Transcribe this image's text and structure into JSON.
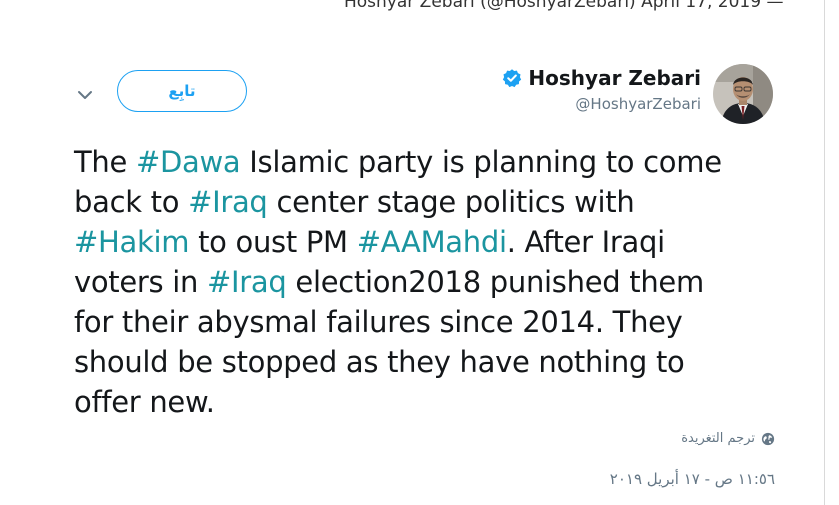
{
  "caption": "Hoshyar Zebari (@HoshyarZebari) April 17, 2019 —",
  "follow_label": "تابِع",
  "author": {
    "display_name": "Hoshyar Zebari",
    "handle": "@HoshyarZebari",
    "verified": true
  },
  "tweet_lines": [
    [
      {
        "t": "The "
      },
      {
        "t": "#Dawa",
        "tag": true
      },
      {
        "t": " Islamic party is planning to come"
      }
    ],
    [
      {
        "t": "back to "
      },
      {
        "t": "#Iraq",
        "tag": true
      },
      {
        "t": " center stage politics with"
      }
    ],
    [
      {
        "t": "#Hakim",
        "tag": true
      },
      {
        "t": "  to oust PM "
      },
      {
        "t": "#AAMahdi",
        "tag": true
      },
      {
        "t": ". After Iraqi"
      }
    ],
    [
      {
        "t": "voters in "
      },
      {
        "t": "#Iraq",
        "tag": true
      },
      {
        "t": " election2018 punished them"
      }
    ],
    [
      {
        "t": "for their abysmal failures since 2014. They"
      }
    ],
    [
      {
        "t": "should be stopped as they have nothing to"
      }
    ],
    [
      {
        "t": "offer new."
      }
    ]
  ],
  "translate_label": "ترجم التغريدة",
  "timestamp": "١١:٥٦ ص - ١٧ أبريل ٢٠١٩",
  "colors": {
    "link": "#1b95a0",
    "follow": "#1da1f2",
    "verified": "#1da1f2",
    "secondary": "#657786"
  },
  "icons": {
    "menu": "chevron-down-icon",
    "verified": "verified-badge-icon",
    "translate": "globe-icon"
  }
}
